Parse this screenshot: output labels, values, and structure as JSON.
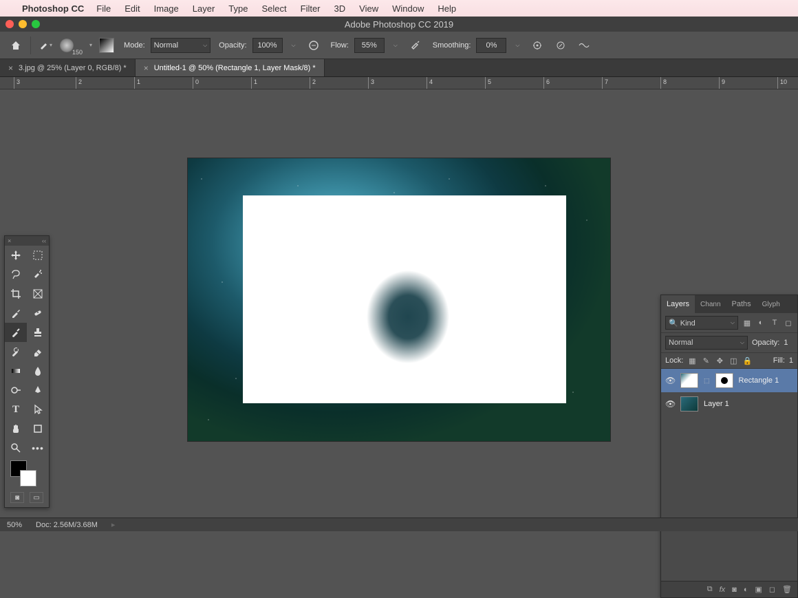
{
  "mac_menu": {
    "app_name": "Photoshop CC",
    "items": [
      "File",
      "Edit",
      "Image",
      "Layer",
      "Type",
      "Select",
      "Filter",
      "3D",
      "View",
      "Window",
      "Help"
    ]
  },
  "window": {
    "title": "Adobe Photoshop CC 2019"
  },
  "options": {
    "brush_size": "150",
    "mode_label": "Mode:",
    "mode_value": "Normal",
    "opacity_label": "Opacity:",
    "opacity_value": "100%",
    "flow_label": "Flow:",
    "flow_value": "55%",
    "smoothing_label": "Smoothing:",
    "smoothing_value": "0%"
  },
  "doc_tabs": [
    {
      "label": "3.jpg @ 25% (Layer 0, RGB/8) *"
    },
    {
      "label": "Untitled-1 @ 50% (Rectangle 1, Layer Mask/8) *"
    }
  ],
  "ruler": [
    "3",
    "2",
    "1",
    "0",
    "1",
    "2",
    "3",
    "4",
    "5",
    "6",
    "7",
    "8",
    "9",
    "10"
  ],
  "layers_panel": {
    "tabs": [
      "Layers",
      "Channels",
      "Paths",
      "Glyphs"
    ],
    "kind_label": "Kind",
    "search_icon": "🔍",
    "blend_mode": "Normal",
    "opacity_label": "Opacity:",
    "opacity_value": "1",
    "lock_label": "Lock:",
    "fill_label": "Fill:",
    "fill_value": "1",
    "layers": [
      {
        "name": "Rectangle 1"
      },
      {
        "name": "Layer 1"
      }
    ],
    "footer_icons": [
      "⬚",
      "fx",
      "◐",
      "◑",
      "▣",
      "🗑"
    ]
  },
  "status": {
    "zoom": "50%",
    "doc_size": "Doc: 2.56M/3.68M"
  },
  "tools": [
    "move",
    "marquee",
    "lasso",
    "wand",
    "crop",
    "frame",
    "eyedropper",
    "healing",
    "brush",
    "stamp",
    "history",
    "eraser",
    "gradient",
    "blur",
    "dodge",
    "pen",
    "type",
    "path-select",
    "hand",
    "rectangle",
    "zoom",
    "more"
  ]
}
